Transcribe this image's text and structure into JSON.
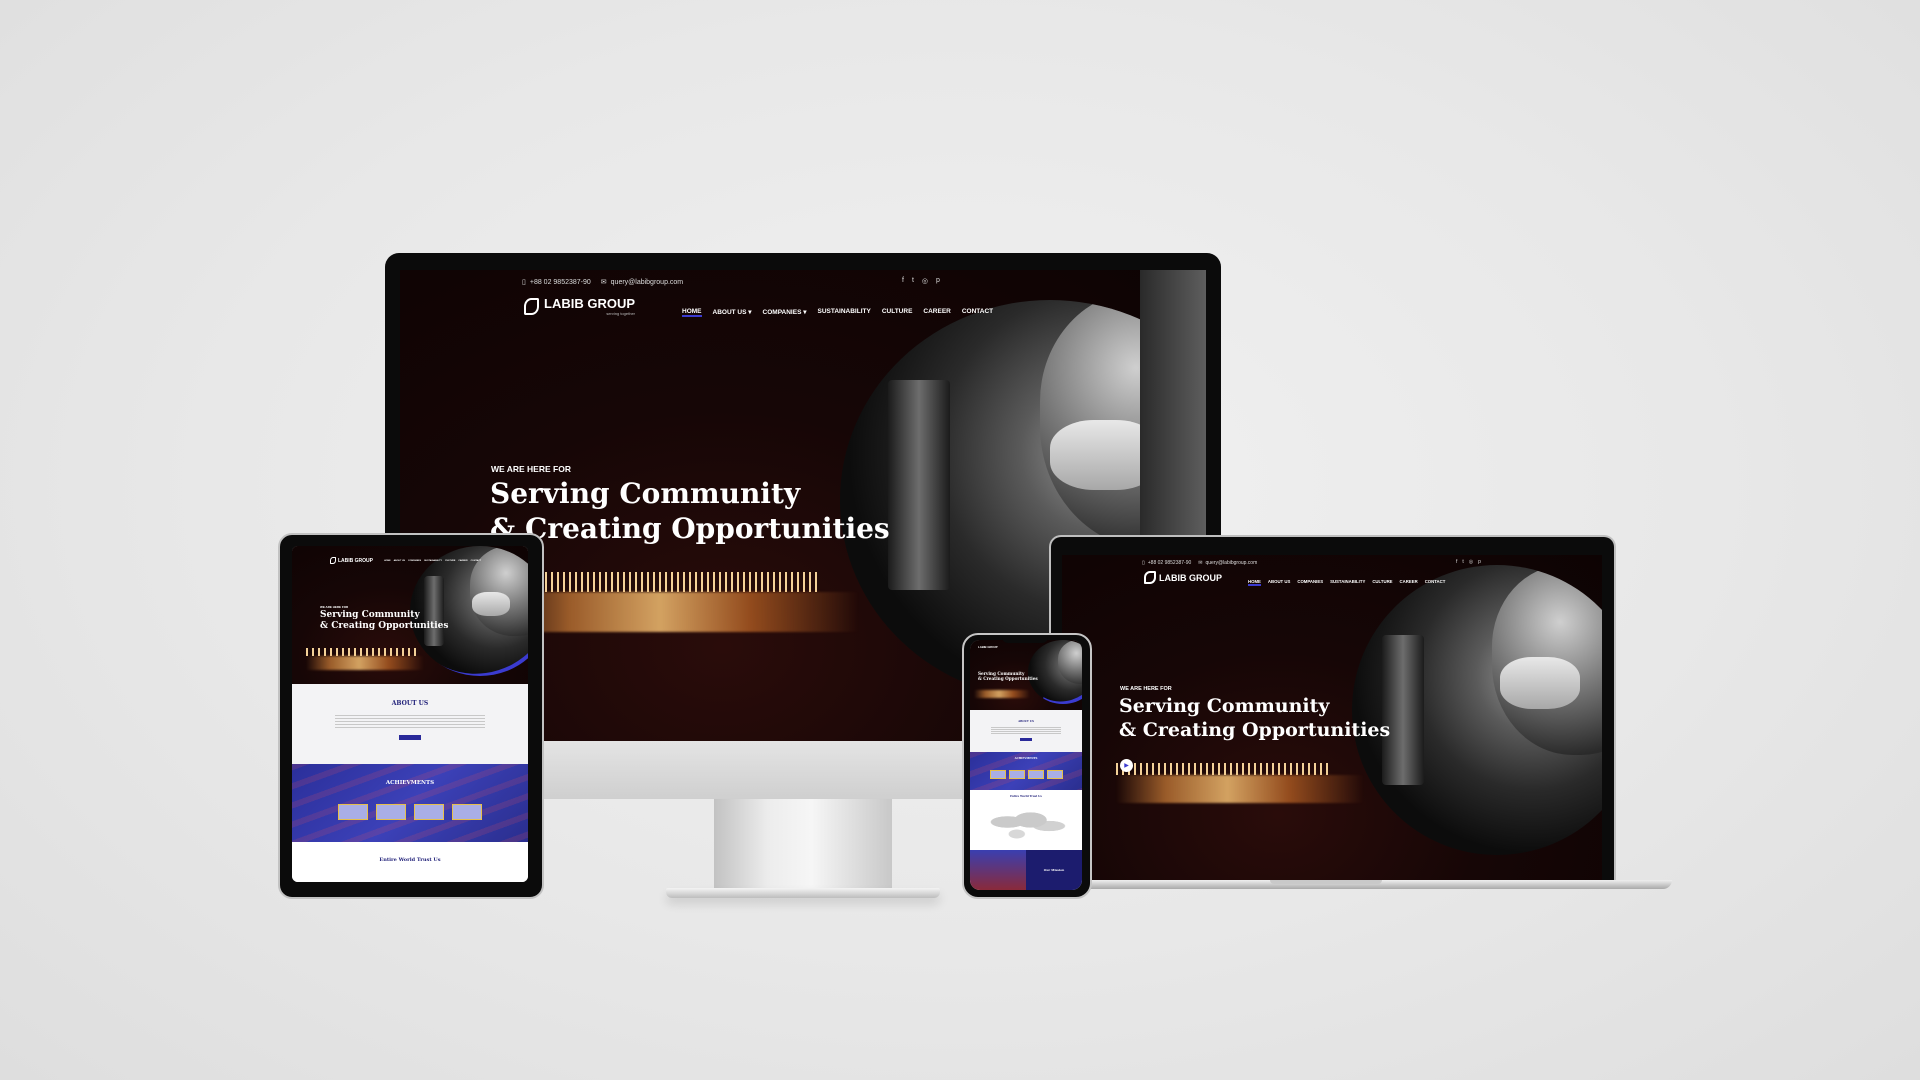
{
  "site": {
    "topbar": {
      "phone": "+88 02 9852387-90",
      "email": "query@labibgroup.com"
    },
    "social_icons": [
      "facebook-icon",
      "twitter-icon",
      "instagram-icon",
      "pinterest-icon"
    ],
    "logo": {
      "name": "LABIB GROUP",
      "tagline": "serving together"
    },
    "nav": [
      {
        "label": "HOME",
        "active": true
      },
      {
        "label": "ABOUT US",
        "dropdown": true
      },
      {
        "label": "COMPANIES",
        "dropdown": true
      },
      {
        "label": "SUSTAINABILITY"
      },
      {
        "label": "CULTURE"
      },
      {
        "label": "CAREER"
      },
      {
        "label": "CONTACT"
      }
    ],
    "hero": {
      "eyebrow": "WE ARE HERE FOR",
      "line1": "Serving Community",
      "line2": "& Creating Opportunities"
    },
    "about": {
      "title": "ABOUT US"
    },
    "achievements": {
      "title": "ACHIEVMENTS"
    },
    "trust": {
      "title": "Entire World Trust Us"
    },
    "vision": {
      "title": "Our Mission"
    }
  },
  "colors": {
    "accent": "#3b3bd0",
    "hero_bg": "#140606",
    "brand_navy": "#22227a"
  }
}
